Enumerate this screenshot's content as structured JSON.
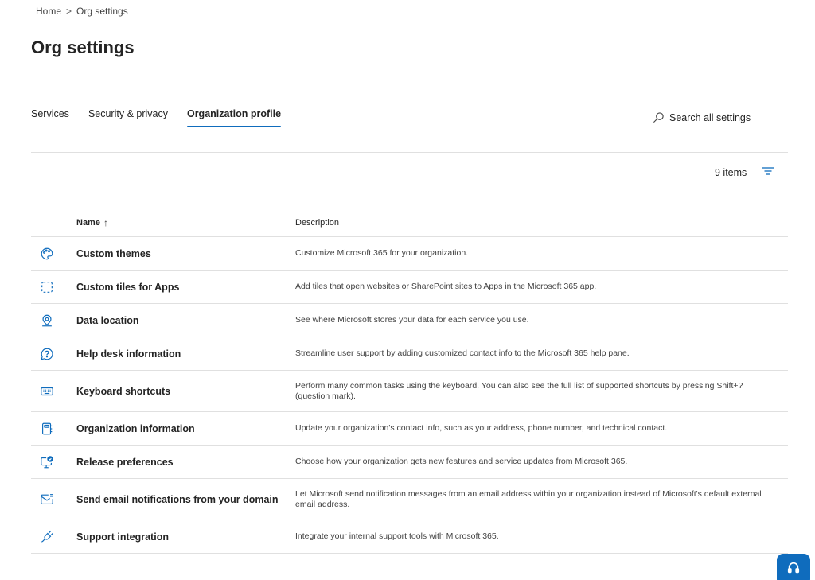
{
  "breadcrumb": {
    "home": "Home",
    "separator": ">",
    "current": "Org settings"
  },
  "page_title": "Org settings",
  "tabs": [
    {
      "label": "Services",
      "active": false
    },
    {
      "label": "Security & privacy",
      "active": false
    },
    {
      "label": "Organization profile",
      "active": true
    }
  ],
  "search": {
    "label": "Search all settings",
    "icon": "search-icon"
  },
  "list_meta": {
    "count": "9 items",
    "filter_icon": "filter-icon"
  },
  "table": {
    "columns": {
      "name": "Name",
      "sort_arrow": "↑",
      "description": "Description"
    },
    "rows": [
      {
        "icon": "palette-icon",
        "name": "Custom themes",
        "description": "Customize Microsoft 365 for your organization."
      },
      {
        "icon": "dashed-tile-icon",
        "name": "Custom tiles for Apps",
        "description": "Add tiles that open websites or SharePoint sites to Apps in the Microsoft 365 app."
      },
      {
        "icon": "location-pin-icon",
        "name": "Data location",
        "description": "See where Microsoft stores your data for each service you use."
      },
      {
        "icon": "help-chat-icon",
        "name": "Help desk information",
        "description": "Streamline user support by adding customized contact info to the Microsoft 365 help pane."
      },
      {
        "icon": "keyboard-icon",
        "name": "Keyboard shortcuts",
        "description": "Perform many common tasks using the keyboard. You can also see the full list of supported shortcuts by pressing Shift+? (question mark)."
      },
      {
        "icon": "contact-card-icon",
        "name": "Organization information",
        "description": "Update your organization's contact info, such as your address, phone number, and technical contact."
      },
      {
        "icon": "desktop-update-icon",
        "name": "Release preferences",
        "description": "Choose how your organization gets new features and service updates from Microsoft 365."
      },
      {
        "icon": "mail-icon",
        "name": "Send email notifications from your domain",
        "description": "Let Microsoft send notification messages from an email address within your organization instead of Microsoft's default external email address."
      },
      {
        "icon": "plug-icon",
        "name": "Support integration",
        "description": "Integrate your internal support tools with Microsoft 365."
      }
    ]
  },
  "help_button": {
    "icon": "headset-icon"
  },
  "colors": {
    "accent": "#0f6cbd",
    "text": "#242424",
    "divider": "#e0e0e0"
  }
}
